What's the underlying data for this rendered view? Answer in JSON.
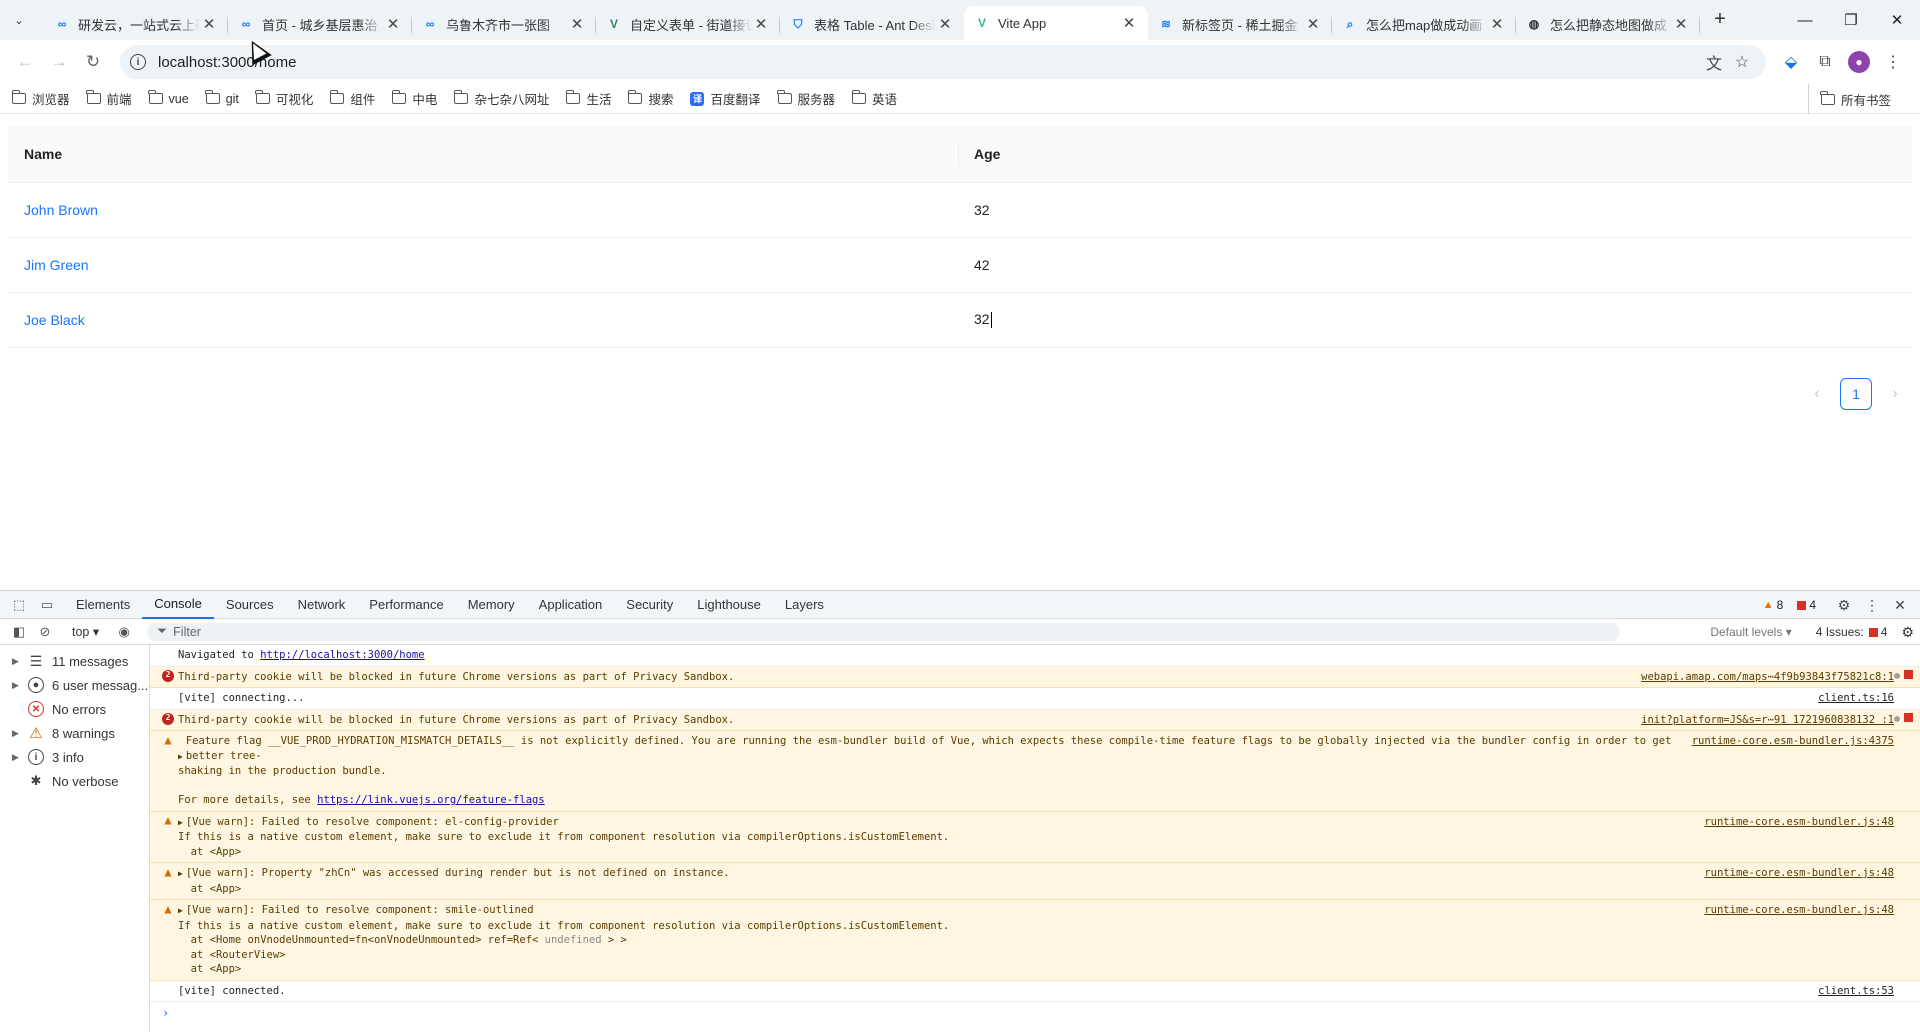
{
  "browser": {
    "tabs": [
      {
        "icon": "∞",
        "icon_color": "#1a73e8",
        "title": "研发云，一站式云上研发",
        "active": false
      },
      {
        "icon": "∞",
        "icon_color": "#1a73e8",
        "title": "首页 - 城乡基层惠治",
        "active": false
      },
      {
        "icon": "∞",
        "icon_color": "#1a73e8",
        "title": "乌鲁木齐市一张图",
        "active": false
      },
      {
        "icon": "V",
        "icon_color": "#2e8b57",
        "title": "自定义表单 - 街道接诉",
        "active": false
      },
      {
        "icon": "⛉",
        "icon_color": "#1677ff",
        "title": "表格 Table - Ant Design",
        "active": false
      },
      {
        "icon": "V",
        "icon_color": "#41b883",
        "title": "Vite App",
        "active": true
      },
      {
        "icon": "≋",
        "icon_color": "#1e80ff",
        "title": "新标签页 - 稀土掘金",
        "active": false
      },
      {
        "icon": "⌕",
        "icon_color": "#1a73e8",
        "title": "怎么把map做成动画",
        "active": false
      },
      {
        "icon": "◍",
        "icon_color": "#333333",
        "title": "怎么把静态地图做成",
        "active": false
      }
    ],
    "url": "localhost:3000/home",
    "bookmarks": [
      {
        "label": "浏览器",
        "type": "folder"
      },
      {
        "label": "前端",
        "type": "folder"
      },
      {
        "label": "vue",
        "type": "folder"
      },
      {
        "label": "git",
        "type": "folder"
      },
      {
        "label": "可视化",
        "type": "folder"
      },
      {
        "label": "组件",
        "type": "folder"
      },
      {
        "label": "中电",
        "type": "folder"
      },
      {
        "label": "杂七杂八网址",
        "type": "folder"
      },
      {
        "label": "生活",
        "type": "folder"
      },
      {
        "label": "搜索",
        "type": "folder"
      },
      {
        "label": "百度翻译",
        "type": "link"
      },
      {
        "label": "服务器",
        "type": "folder"
      },
      {
        "label": "英语",
        "type": "folder"
      }
    ],
    "all_bookmarks": "所有书签"
  },
  "table": {
    "headers": [
      "Name",
      "Age"
    ],
    "rows": [
      {
        "name": "John Brown",
        "age": "32"
      },
      {
        "name": "Jim Green",
        "age": "42"
      },
      {
        "name": "Joe Black",
        "age": "32"
      }
    ],
    "current_page": "1"
  },
  "devtools": {
    "tabs": [
      "Elements",
      "Console",
      "Sources",
      "Network",
      "Performance",
      "Memory",
      "Application",
      "Security",
      "Lighthouse",
      "Layers"
    ],
    "active_tab": "Console",
    "warning_count": "8",
    "error_count": "4",
    "context": "top",
    "filter_placeholder": "Filter",
    "levels": "Default levels",
    "issues_label": "4 Issues:",
    "issues_count": "4",
    "sidebar": [
      {
        "label": "11 messages",
        "icon": "list",
        "expandable": true
      },
      {
        "label": "6 user messag...",
        "icon": "user",
        "expandable": true
      },
      {
        "label": "No errors",
        "icon": "error",
        "expandable": false
      },
      {
        "label": "8 warnings",
        "icon": "warning",
        "expandable": true
      },
      {
        "label": "3 info",
        "icon": "info",
        "expandable": true
      },
      {
        "label": "No verbose",
        "icon": "verbose",
        "expandable": false
      }
    ],
    "messages": {
      "m1_text": "Navigated to ",
      "m1_link": "http://localhost:3000/home",
      "m2_text": "Third-party cookie will be blocked in future Chrome versions as part of Privacy Sandbox.",
      "m2_count": "2",
      "m2_src": "webapi.amap.com/maps⋯4f9b93843f75821c8:1",
      "m3_text": "[vite] connecting...",
      "m3_src": "client.ts:16",
      "m4_text": "Third-party cookie will be blocked in future Chrome versions as part of Privacy Sandbox.",
      "m4_count": "2",
      "m4_src": "init?platform=JS&s=r⋯91 1721960838132 :1",
      "m5_line1": "Feature flag __VUE_PROD_HYDRATION_MISMATCH_DETAILS__ is not explicitly defined. You are running the esm-bundler build of Vue, which expects these compile-time feature flags to be globally injected via the bundler config in order to get better tree-",
      "m5_line2": "shaking in the production bundle.",
      "m5_line3": "For more details, see ",
      "m5_link": "https://link.vuejs.org/feature-flags",
      "m5_src": "runtime-core.esm-bundler.js:4375",
      "m6_line1": "[Vue warn]: Failed to resolve component: el-config-provider",
      "m6_line2": "If this is a native custom element, make sure to exclude it from component resolution via compilerOptions.isCustomElement.",
      "m6_line3": "  at <App>",
      "m6_src": "runtime-core.esm-bundler.js:48",
      "m7_line1": "[Vue warn]: Property \"zhCn\" was accessed during render but is not defined on instance.",
      "m7_line2": "  at <App>",
      "m7_src": "runtime-core.esm-bundler.js:48",
      "m8_line1": "[Vue warn]: Failed to resolve component: smile-outlined",
      "m8_line2": "If this is a native custom element, make sure to exclude it from component resolution via compilerOptions.isCustomElement.",
      "m8_line3a": "  at <Home onVnodeUnmounted=fn<onVnodeUnmounted> ref=Ref< ",
      "m8_line3b": "undefined",
      "m8_line3c": " > >",
      "m8_line4": "  at <RouterView>",
      "m8_line5": "  at <App>",
      "m8_src": "runtime-core.esm-bundler.js:48",
      "m9_text": "[vite] connected.",
      "m9_src": "client.ts:53"
    }
  }
}
